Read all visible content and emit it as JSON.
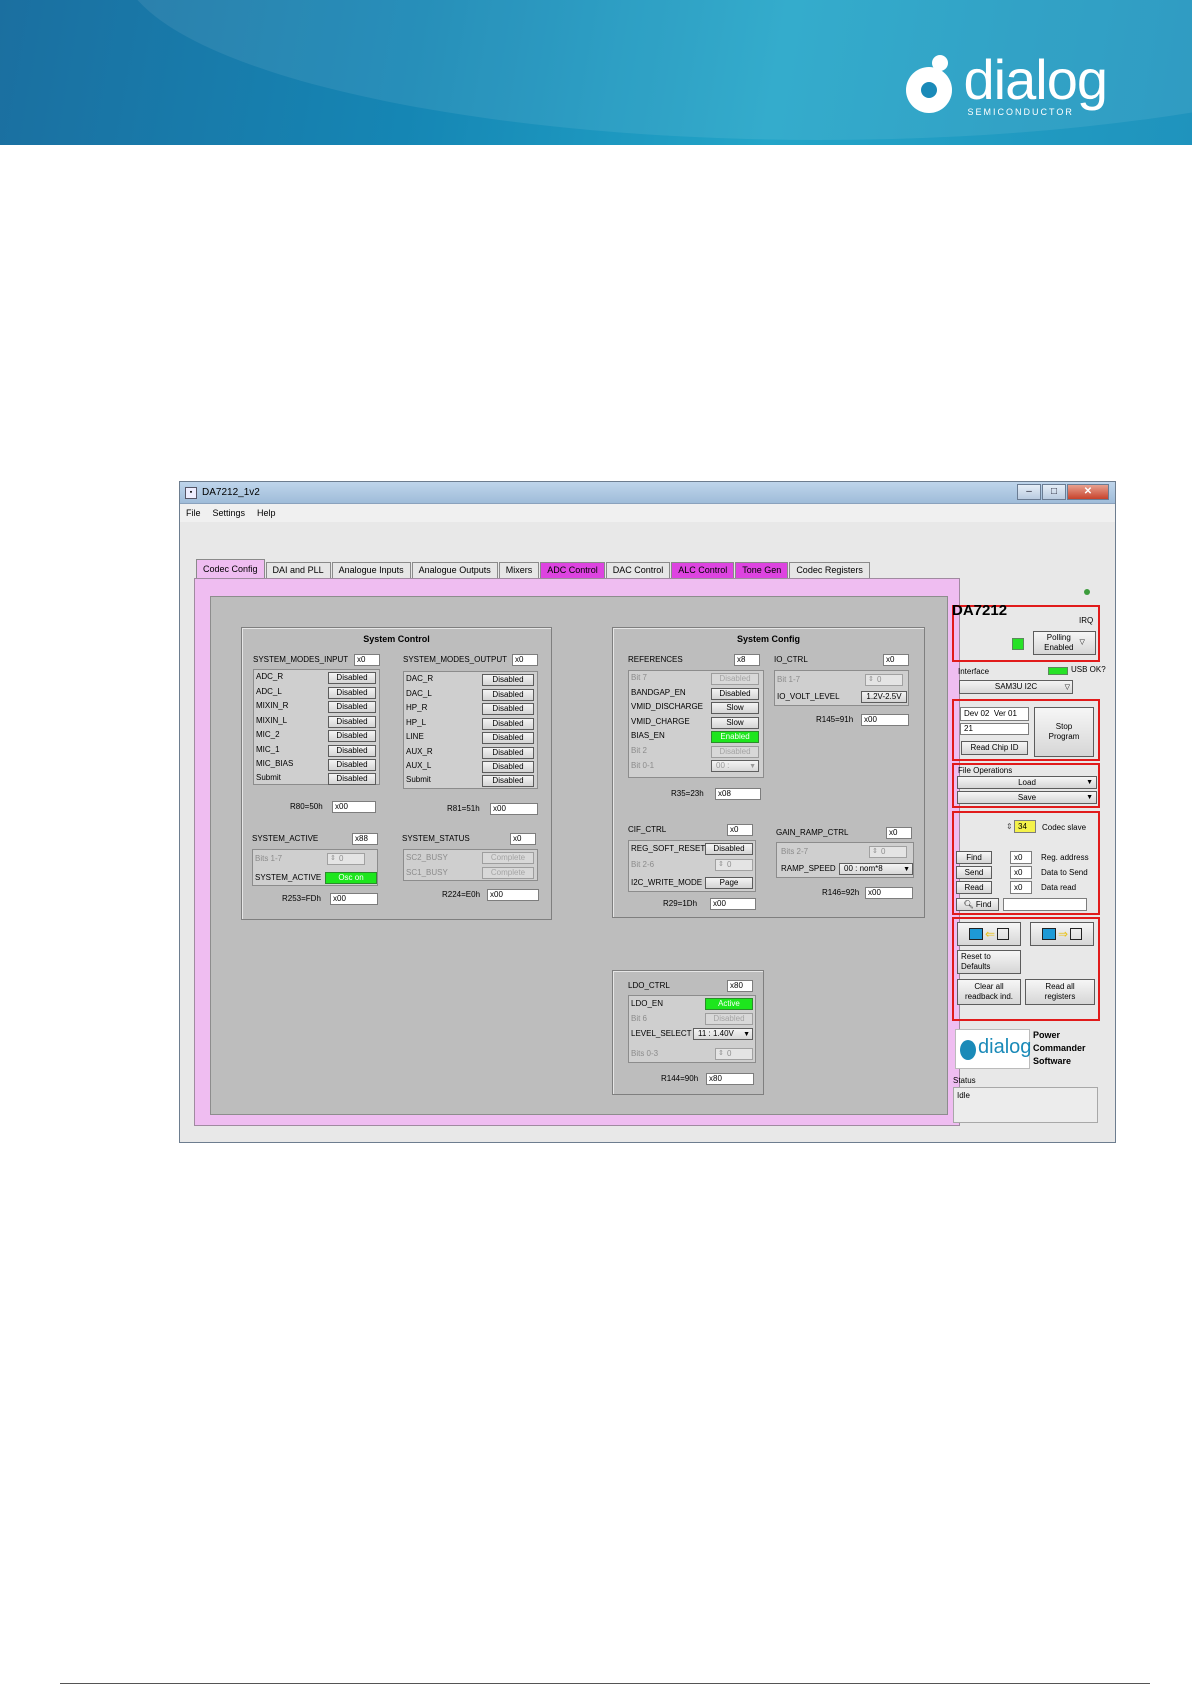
{
  "window": {
    "title": "DA7212_1v2",
    "menu": [
      "File",
      "Settings",
      "Help"
    ]
  },
  "tabs": [
    "Codec Config",
    "DAI and PLL",
    "Analogue Inputs",
    "Analogue Outputs",
    "Mixers",
    "ADC Control",
    "DAC Control",
    "ALC Control",
    "Tone Gen",
    "Codec Registers"
  ],
  "system_control": {
    "title": "System Control",
    "modes_input": {
      "label": "SYSTEM_MODES_INPUT",
      "value": "x0",
      "rows": [
        {
          "name": "ADC_R",
          "state": "Disabled"
        },
        {
          "name": "ADC_L",
          "state": "Disabled"
        },
        {
          "name": "MIXIN_R",
          "state": "Disabled"
        },
        {
          "name": "MIXIN_L",
          "state": "Disabled"
        },
        {
          "name": "MIC_2",
          "state": "Disabled"
        },
        {
          "name": "MIC_1",
          "state": "Disabled"
        },
        {
          "name": "MIC_BIAS",
          "state": "Disabled"
        },
        {
          "name": "Submit",
          "state": "Disabled"
        }
      ],
      "reg_label": "R80=50h",
      "reg_value": "x00"
    },
    "modes_output": {
      "label": "SYSTEM_MODES_OUTPUT",
      "value": "x0",
      "rows": [
        {
          "name": "DAC_R",
          "state": "Disabled"
        },
        {
          "name": "DAC_L",
          "state": "Disabled"
        },
        {
          "name": "HP_R",
          "state": "Disabled"
        },
        {
          "name": "HP_L",
          "state": "Disabled"
        },
        {
          "name": "LINE",
          "state": "Disabled"
        },
        {
          "name": "AUX_R",
          "state": "Disabled"
        },
        {
          "name": "AUX_L",
          "state": "Disabled"
        },
        {
          "name": "Submit",
          "state": "Disabled"
        }
      ],
      "reg_label": "R81=51h",
      "reg_value": "x00"
    },
    "system_active": {
      "label": "SYSTEM_ACTIVE",
      "value": "x88",
      "bits_label": "Bits 1-7",
      "bits_value": "0",
      "row_label": "SYSTEM_ACTIVE",
      "row_state": "Osc on",
      "reg_label": "R253=FDh",
      "reg_value": "x00"
    },
    "system_status": {
      "label": "SYSTEM_STATUS",
      "value": "x0",
      "rows": [
        {
          "name": "SC2_BUSY",
          "state": "Complete"
        },
        {
          "name": "SC1_BUSY",
          "state": "Complete"
        }
      ],
      "reg_label": "R224=E0h",
      "reg_value": "x00"
    }
  },
  "system_config": {
    "title": "System Config",
    "references": {
      "label": "REFERENCES",
      "value": "x8",
      "rows": [
        {
          "name": "Bit 7",
          "state": "Disabled"
        },
        {
          "name": "BANDGAP_EN",
          "state": "Disabled"
        },
        {
          "name": "VMID_DISCHARGE",
          "state": "Slow"
        },
        {
          "name": "VMID_CHARGE",
          "state": "Slow"
        },
        {
          "name": "BIAS_EN",
          "state": "Enabled"
        },
        {
          "name": "Bit 2",
          "state": "Disabled"
        },
        {
          "name": "Bit 0-1",
          "state": "00 :"
        }
      ],
      "reg_label": "R35=23h",
      "reg_value": "x08"
    },
    "io_ctrl": {
      "label": "IO_CTRL",
      "value": "x0",
      "bits_label": "Bit 1-7",
      "bits_value": "0",
      "row_label": "IO_VOLT_LEVEL",
      "row_state": "1.2V-2.5V",
      "reg_label": "R145=91h",
      "reg_value": "x00"
    },
    "cif_ctrl": {
      "label": "CIF_CTRL",
      "value": "x0",
      "row1_label": "REG_SOFT_RESET",
      "row1_state": "Disabled",
      "bits_label": "Bit 2-6",
      "bits_value": "0",
      "row2_label": "I2C_WRITE_MODE",
      "row2_state": "Page",
      "reg_label": "R29=1Dh",
      "reg_value": "x00"
    },
    "gain_ramp_ctrl": {
      "label": "GAIN_RAMP_CTRL",
      "value": "x0",
      "bits_label": "Bits 2-7",
      "bits_value": "0",
      "row_label": "RAMP_SPEED",
      "row_state": "00 : nom*8",
      "reg_label": "R146=92h",
      "reg_value": "x00"
    }
  },
  "ldo_ctrl": {
    "label": "LDO_CTRL",
    "value": "x80",
    "row1_label": "LDO_EN",
    "row1_state": "Active",
    "row2_label": "Bit 6",
    "row2_state": "Disabled",
    "row3_label": "LEVEL_SELECT",
    "row3_state": "11 : 1.40V",
    "bits_label": "Bits 0-3",
    "bits_value": "0",
    "reg_label": "R144=90h",
    "reg_value": "x80"
  },
  "side": {
    "chip": "DA7212",
    "irq": "IRQ",
    "polling": "Polling\nEnabled",
    "interface_label": "Interface",
    "usb_ok": "USB OK?",
    "interface_value": "SAM3U I2C",
    "dev": "Dev 02",
    "ver": "Ver 01",
    "chip_id": "21",
    "read_chip_id": "Read Chip ID",
    "stop_program": "Stop\nProgram",
    "file_ops": "File Operations",
    "load": "Load",
    "save": "Save",
    "codec_slave_value": "34",
    "codec_slave": "Codec slave",
    "find": "Find",
    "send": "Send",
    "read": "Read",
    "reg_address": "Reg. address",
    "data_to_send": "Data to Send",
    "data_read": "Data read",
    "reg_value": "x0",
    "send_value": "x0",
    "read_value": "x0",
    "find_search": "Find",
    "reset_defaults": "Reset to\nDefaults",
    "clear_readback": "Clear all\nreadback ind.",
    "read_all": "Read all\nregisters",
    "pc_title": "Power\nCommander\nSoftware",
    "status_label": "Status",
    "status_value": "Idle"
  },
  "brand": {
    "name": "dialog",
    "sub": "SEMICONDUCTOR"
  },
  "colors": {
    "tab_panel": "#efbdf1",
    "magenta_tab": "#dd44e0",
    "active_green": "#1de61d",
    "highlight_red": "#e11b1b"
  }
}
